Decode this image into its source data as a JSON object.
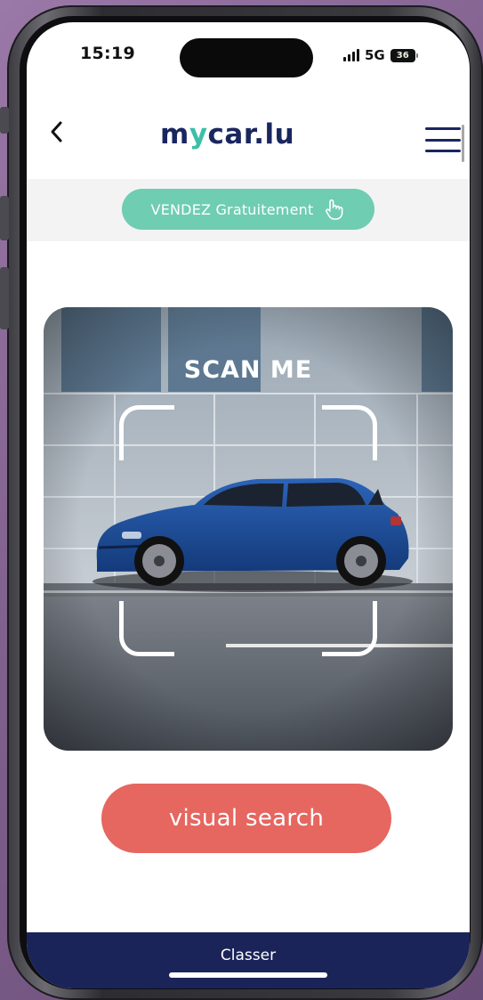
{
  "status_bar": {
    "time": "15:19",
    "network": "5G",
    "battery": "36"
  },
  "header": {
    "back_icon": "chevron-left-icon",
    "logo_part1": "m",
    "logo_part2": "y",
    "logo_part3": "car.lu",
    "menu_icon": "hamburger-menu-icon"
  },
  "promo": {
    "sell_label": "VENDEZ Gratuitement",
    "sell_icon": "pointing-hand-icon"
  },
  "scan": {
    "title": "SCAN ME"
  },
  "actions": {
    "visual_search_label": "visual search"
  },
  "bottom_bar": {
    "label": "Classer"
  },
  "colors": {
    "brand_navy": "#1a2660",
    "brand_teal": "#3dbfa7",
    "sell_pill": "#6fcdb1",
    "visual_search": "#e66660",
    "bottom_bar": "#1b2459"
  }
}
